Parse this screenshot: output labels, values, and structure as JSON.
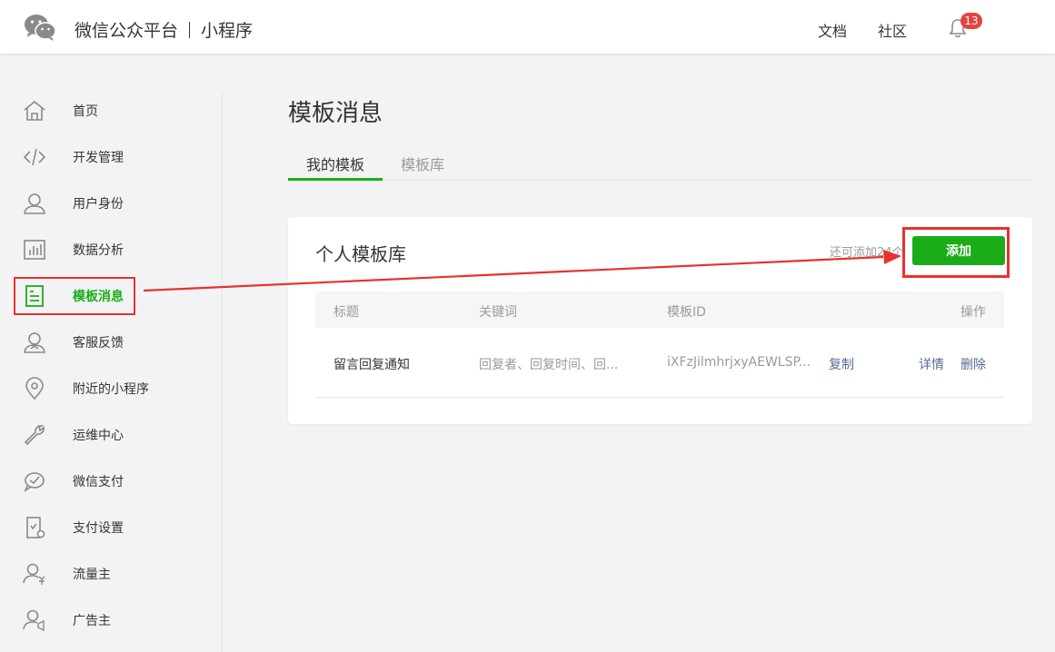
{
  "header": {
    "brand": "微信公众平台",
    "product": "小程序",
    "links": [
      "文档",
      "社区"
    ],
    "notification_count": "13"
  },
  "sidebar": {
    "items": [
      {
        "label": "首页",
        "icon": "home-icon"
      },
      {
        "label": "开发管理",
        "icon": "code-icon"
      },
      {
        "label": "用户身份",
        "icon": "user-icon"
      },
      {
        "label": "数据分析",
        "icon": "chart-icon"
      },
      {
        "label": "模板消息",
        "icon": "template-icon"
      },
      {
        "label": "客服反馈",
        "icon": "service-icon"
      },
      {
        "label": "附近的小程序",
        "icon": "location-icon"
      },
      {
        "label": "运维中心",
        "icon": "wrench-icon"
      },
      {
        "label": "微信支付",
        "icon": "pay-icon"
      },
      {
        "label": "支付设置",
        "icon": "pay-settings-icon"
      },
      {
        "label": "流量主",
        "icon": "traffic-icon"
      },
      {
        "label": "广告主",
        "icon": "advertiser-icon"
      }
    ],
    "active_index": 4
  },
  "main": {
    "title": "模板消息",
    "tabs": [
      {
        "label": "我的模板",
        "active": true
      },
      {
        "label": "模板库",
        "active": false
      }
    ],
    "card": {
      "title": "个人模板库",
      "remaining_text": "还可添加24个",
      "add_label": "添加",
      "columns": [
        "标题",
        "关键词",
        "模板ID",
        "操作"
      ],
      "rows": [
        {
          "title": "留言回复通知",
          "keywords": "回复者、回复时间、回...",
          "template_id": "iXFzJilmhrjxyAEWLSP...",
          "copy_label": "复制",
          "detail_label": "详情",
          "delete_label": "删除"
        }
      ]
    }
  },
  "colors": {
    "accent": "#1aad19",
    "highlight": "#e8312f",
    "link": "#576b95",
    "badge": "#e64340"
  }
}
